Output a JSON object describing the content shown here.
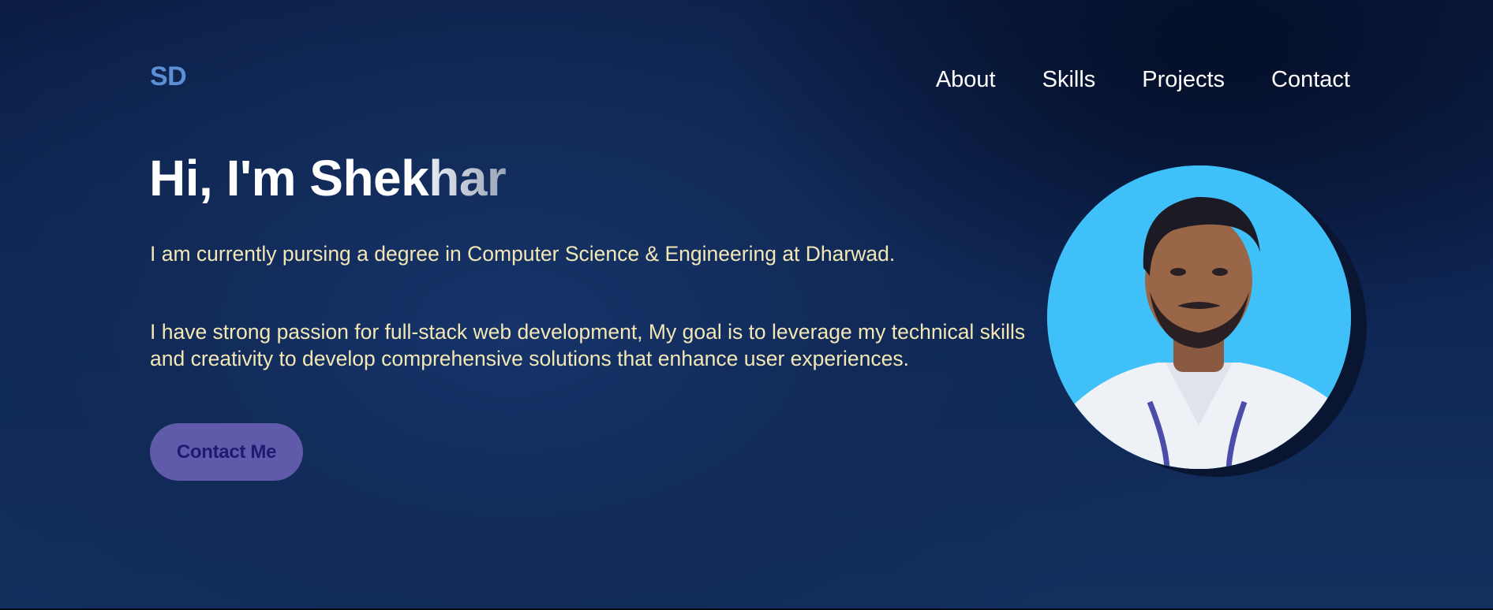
{
  "header": {
    "logo": "SD",
    "nav": [
      "About",
      "Skills",
      "Projects",
      "Contact"
    ]
  },
  "hero": {
    "greeting": "Hi, I'm Shek",
    "greeting_fade": "har",
    "para1": "I am currently pursing a degree in Computer Science & Engineering at Dharwad.",
    "para2": "I have strong passion for full-stack web development, My goal is to leverage my technical skills and creativity to develop comprehensive solutions that enhance user experiences.",
    "cta": "Contact Me"
  },
  "colors": {
    "accent_logo": "#5b8fd6",
    "paragraph_text": "#f3e7b4",
    "button_bg": "#5f5aaa",
    "button_text": "#1f1a6e",
    "avatar_bg": "#3fc0f8"
  }
}
